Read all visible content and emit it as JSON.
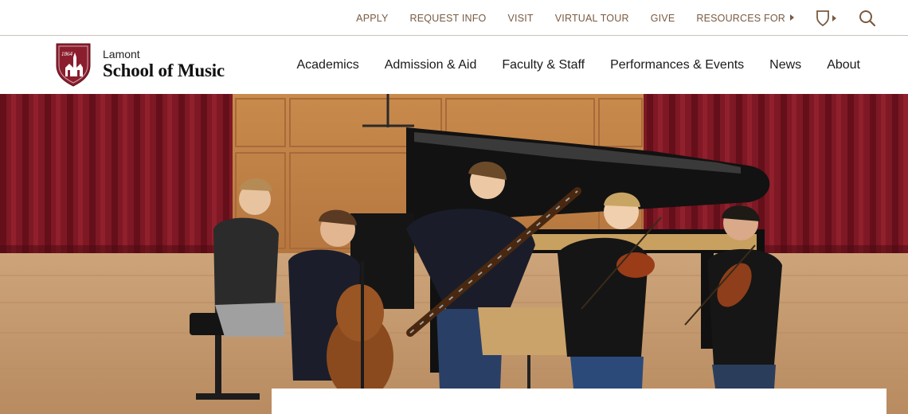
{
  "utility_nav": {
    "links": [
      "APPLY",
      "REQUEST INFO",
      "VISIT",
      "VIRTUAL TOUR",
      "GIVE",
      "RESOURCES FOR"
    ],
    "shield_icon": "du-shield-icon",
    "search_icon": "search-icon"
  },
  "logo": {
    "line1": "Lamont",
    "line2": "School of Music",
    "crest_text": "1864"
  },
  "main_nav": [
    "Academics",
    "Admission & Aid",
    "Faculty & Staff",
    "Performances & Events",
    "News",
    "About"
  ],
  "colors": {
    "accent": "#7a5a40",
    "crest": "#8b1e2e",
    "curtain": "#8a1c28",
    "text": "#1a1a1a"
  }
}
